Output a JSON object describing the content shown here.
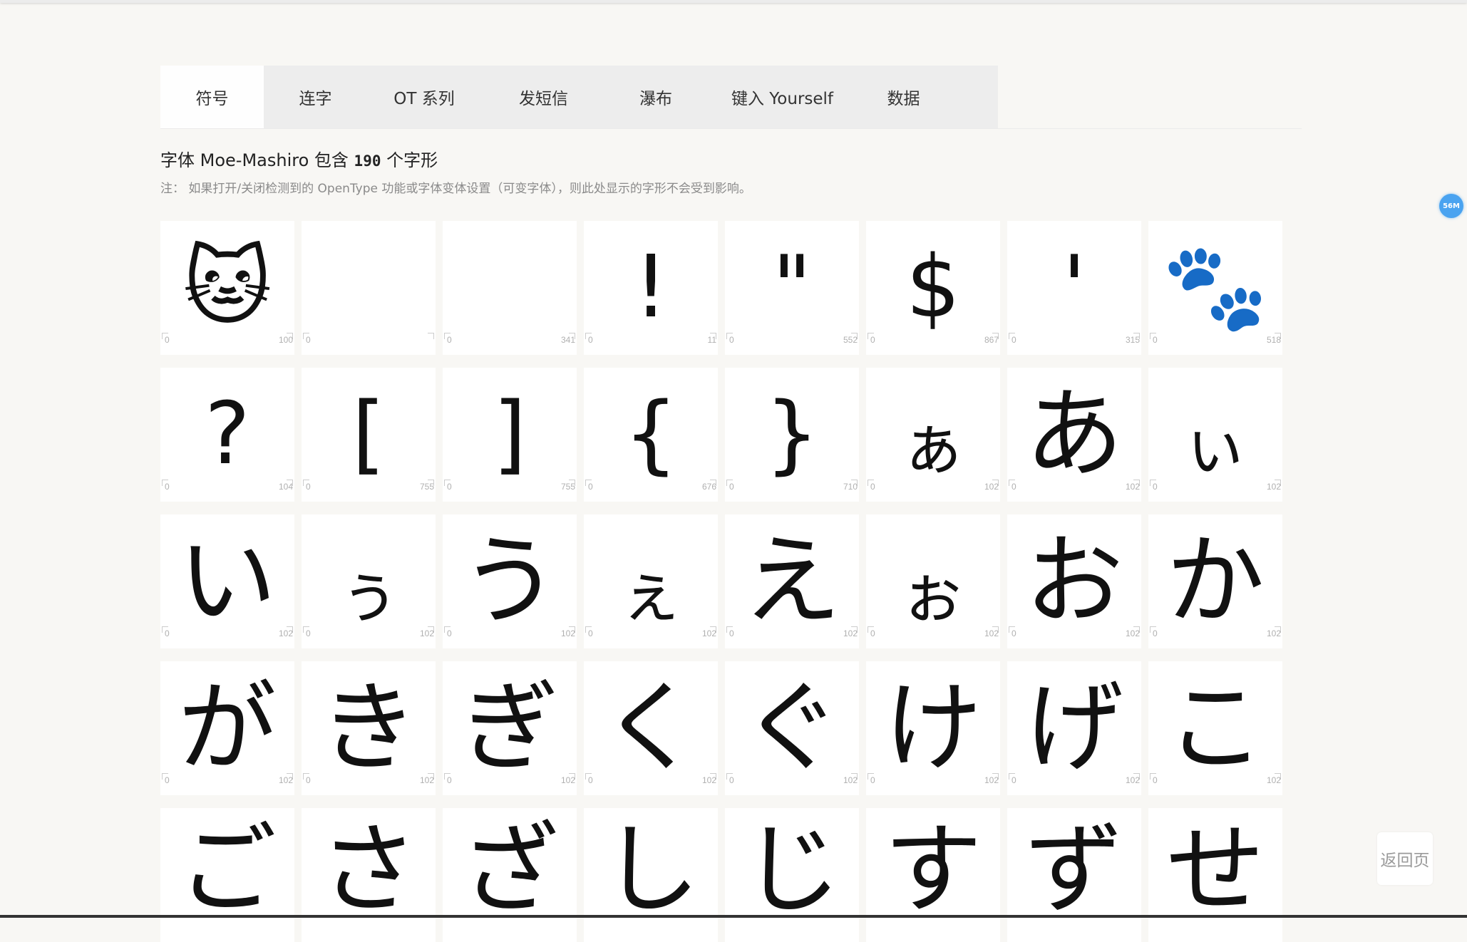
{
  "tabs": [
    {
      "label": "符号",
      "active": true
    },
    {
      "label": "连字"
    },
    {
      "label": "OT 系列"
    },
    {
      "label": "发短信"
    },
    {
      "label": "瀑布"
    },
    {
      "label": "键入 Yourself"
    },
    {
      "label": "数据"
    }
  ],
  "heading": {
    "prefix": "字体 Moe-Mashiro 包含",
    "count": "190",
    "suffix": "个字形"
  },
  "note": "注： 如果打开/关闭检测到的 OpenType 功能或字体变体设置（可变字体），则此处显示的字形不会受到影响。",
  "glyphs": [
    {
      "char": "🐱",
      "icon": "cat-face-icon",
      "left": "0",
      "right": "100"
    },
    {
      "char": "",
      "icon": "blank-glyph",
      "left": "0",
      "right": ""
    },
    {
      "char": "",
      "icon": "blank-glyph",
      "left": "0",
      "right": "341"
    },
    {
      "char": "!",
      "icon": "exclamation-burst-icon",
      "left": "0",
      "right": "11"
    },
    {
      "char": "\"",
      "icon": "quote-mark-icon",
      "left": "0",
      "right": "552"
    },
    {
      "char": "$",
      "icon": "dollar-icon",
      "left": "0",
      "right": "867"
    },
    {
      "char": "'",
      "icon": "apostrophe-icon",
      "left": "0",
      "right": "315"
    },
    {
      "char": "🐾",
      "icon": "paw-icon",
      "left": "0",
      "right": "518"
    },
    {
      "char": "?",
      "icon": "question-cat-icon",
      "left": "0",
      "right": "104"
    },
    {
      "char": "[",
      "icon": "cat-left-bracket-icon",
      "left": "0",
      "right": "755"
    },
    {
      "char": "]",
      "icon": "cat-right-bracket-icon",
      "left": "0",
      "right": "755"
    },
    {
      "char": "{",
      "icon": "cat-left-brace-icon",
      "left": "0",
      "right": "676"
    },
    {
      "char": "}",
      "icon": "cat-right-brace-icon",
      "left": "0",
      "right": "710"
    },
    {
      "char": "ぁ",
      "icon": "",
      "left": "0",
      "right": "102"
    },
    {
      "char": "あ",
      "icon": "",
      "left": "0",
      "right": "102"
    },
    {
      "char": "ぃ",
      "icon": "",
      "left": "0",
      "right": "102"
    },
    {
      "char": "い",
      "icon": "",
      "left": "0",
      "right": "102"
    },
    {
      "char": "ぅ",
      "icon": "",
      "left": "0",
      "right": "102"
    },
    {
      "char": "う",
      "icon": "",
      "left": "0",
      "right": "102"
    },
    {
      "char": "ぇ",
      "icon": "",
      "left": "0",
      "right": "102"
    },
    {
      "char": "え",
      "icon": "",
      "left": "0",
      "right": "102"
    },
    {
      "char": "ぉ",
      "icon": "",
      "left": "0",
      "right": "102"
    },
    {
      "char": "お",
      "icon": "",
      "left": "0",
      "right": "102"
    },
    {
      "char": "か",
      "icon": "",
      "left": "0",
      "right": "102"
    },
    {
      "char": "が",
      "icon": "",
      "left": "0",
      "right": "102"
    },
    {
      "char": "き",
      "icon": "",
      "left": "0",
      "right": "102"
    },
    {
      "char": "ぎ",
      "icon": "",
      "left": "0",
      "right": "102"
    },
    {
      "char": "く",
      "icon": "",
      "left": "0",
      "right": "102"
    },
    {
      "char": "ぐ",
      "icon": "",
      "left": "0",
      "right": "102"
    },
    {
      "char": "け",
      "icon": "",
      "left": "0",
      "right": "102"
    },
    {
      "char": "げ",
      "icon": "",
      "left": "0",
      "right": "102"
    },
    {
      "char": "こ",
      "icon": "",
      "left": "0",
      "right": "102"
    },
    {
      "char": "ご",
      "icon": "",
      "left": "",
      "right": ""
    },
    {
      "char": "さ",
      "icon": "",
      "left": "",
      "right": ""
    },
    {
      "char": "ざ",
      "icon": "",
      "left": "",
      "right": ""
    },
    {
      "char": "し",
      "icon": "",
      "left": "",
      "right": ""
    },
    {
      "char": "じ",
      "icon": "",
      "left": "",
      "right": ""
    },
    {
      "char": "す",
      "icon": "",
      "left": "",
      "right": ""
    },
    {
      "char": "ず",
      "icon": "",
      "left": "",
      "right": ""
    },
    {
      "char": "せ",
      "icon": "",
      "left": "",
      "right": ""
    }
  ],
  "badge": "56M",
  "back_label": "返回页",
  "colors": {
    "badge": "#4aa3f0",
    "page_bg": "#f8f7f4",
    "tab_bg": "#ededed"
  }
}
